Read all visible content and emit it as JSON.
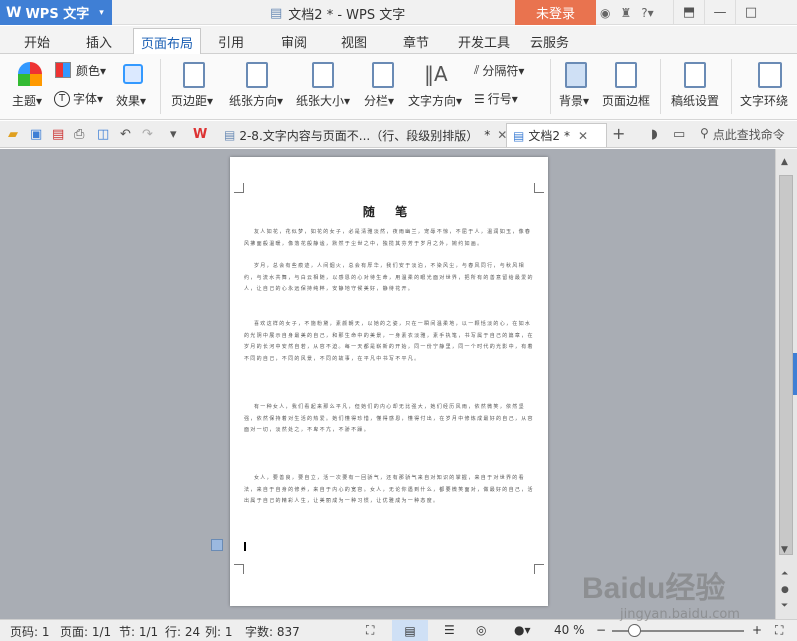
{
  "app": {
    "name": "WPS 文字",
    "logo": "W",
    "title": "文档2 * - WPS 文字",
    "login_label": "未登录"
  },
  "menu": {
    "tabs": [
      "开始",
      "插入",
      "页面布局",
      "引用",
      "审阅",
      "视图",
      "章节",
      "开发工具",
      "云服务"
    ],
    "active": "页面布局"
  },
  "ribbon": {
    "theme": "主题",
    "colors": "颜色",
    "fonts": "字体",
    "effects": "效果",
    "margins": "页边距",
    "orientation": "纸张方向",
    "size": "纸张大小",
    "columns": "分栏",
    "text_direction": "文字方向",
    "breaks": "分隔符",
    "line_numbers": "行号",
    "background": "背景",
    "page_border": "页面边框",
    "manuscript": "稿纸设置",
    "wrap": "文字环绕"
  },
  "doc_tabs": [
    {
      "label": "2-8.文字内容与页面不...（行、段级别排版）",
      "mark": "*"
    },
    {
      "label": "文档2",
      "mark": "*"
    }
  ],
  "search_label": "点此查找命令",
  "document": {
    "title": "随 笔",
    "paragraphs": [
      "友人如花，花似梦，如花的女子，必是清雅淡然，夜雨幽兰，宠辱不惊，不屈于人，温润如玉，像春风拂面般温暖，像落花般静谧，默然于尘世之中，独揽其芬芳于岁月之外，婉约如画。",
      "岁月，总会有些痕迹，人间烟火，总会有厚华，我们安于淡泊，不染风尘，与春风同行，与秋风相约，与流水共舞，与白云相随，以感恩的心对待生命，用温柔的眼光面对世界，把所有的善意留给最爱的人，让自己的心永远保持纯粹，安静地守候美好，静待花开。",
      "喜欢这样的女子，不施粉黛，素颜朝天，以她的之姿，只在一瞬间温柔地，以一颗恬淡的心，在如水的光阴中展示自身最美的自己，和那生命中的美景，一身素衣淡雅，素手执笔，书写属于自己的篇章，在岁月的长河中安然自若，从容不迫。每一天都是崭新的开始，同一份宁静里，同一个时代的光影中，有着不同的自己，不同的风景，不同的故事，在平凡中书写不平凡。",
      "有一种女人，我们看起来那么平凡，但她们的内心却无比强大，她们经历风雨，依然微笑，依然坚强，依然保持着对生活的热爱。她们懂得珍惜，懂得感恩，懂得付出，在岁月中修炼成最好的自己，从容面对一切，淡然处之，不卑不亢，不骄不躁。",
      "女人，要善良，要自立，活一次要有一回骄气，还有那骄气来自对知识的掌握，来自于对世界的看法，来自于自身的修养，来自于内心的宽容。女人，无论你遇到什么，都要微笑面对，做最好的自己，活出属于自己的精彩人生，让美丽成为一种习惯，让优雅成为一种态度。"
    ]
  },
  "status": {
    "page_no": "页码: 1",
    "pages": "页面: 1/1",
    "section": "节: 1/1",
    "line": "行: 24",
    "column": "列: 1",
    "words": "字数: 837",
    "zoom": "40 %"
  },
  "watermark": {
    "brand": "Baidu经验",
    "url": "jingyan.baidu.com"
  },
  "colors": {
    "accent": "#3f7fd5",
    "login": "#e9734f",
    "workspace": "#a9adb4"
  }
}
